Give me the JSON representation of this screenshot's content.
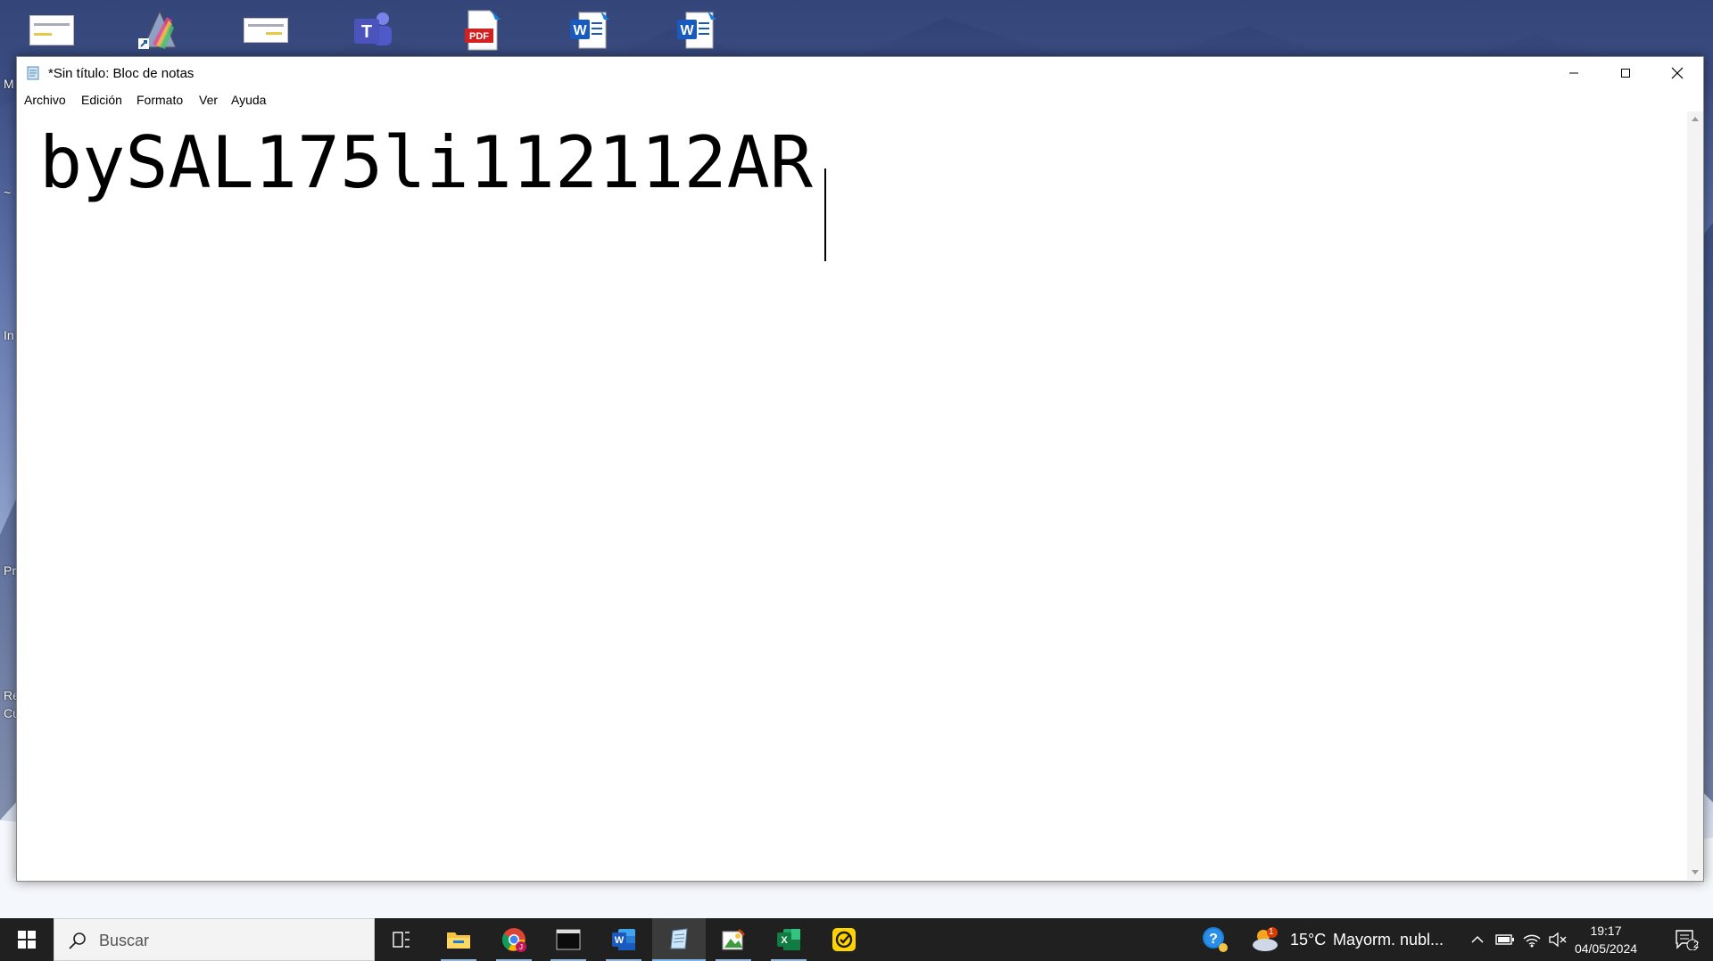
{
  "window": {
    "title": "*Sin título: Bloc de notas",
    "controls": [
      "minimize-icon",
      "maximize-icon",
      "close-icon"
    ]
  },
  "menu": [
    {
      "label": "Archivo"
    },
    {
      "label": "Edición"
    },
    {
      "label": "Formato"
    },
    {
      "label": "Ver"
    },
    {
      "label": "Ayuda"
    }
  ],
  "editor": {
    "content": "bySAL175li112112AR"
  },
  "desktop": {
    "icons": [
      "document-thumbnail-icon",
      "prism-shortcut-icon",
      "document-thumbnail-icon",
      "teams-icon",
      "pdf-icon",
      "word-document-icon",
      "word-document-icon"
    ],
    "edge_labels": [
      "M",
      "~",
      "In",
      "Pr",
      "Re",
      "Cu"
    ]
  },
  "taskbar": {
    "search_placeholder": "Buscar",
    "apps": [
      "task-view-icon",
      "file-explorer-icon",
      "chrome-icon",
      "terminal-icon",
      "word-icon",
      "notepad-icon",
      "image-editor-icon",
      "excel-icon",
      "norton-icon"
    ],
    "weather": {
      "temperature": "15°C",
      "condition": "Mayorm. nubl...",
      "badge": "1"
    },
    "clock": {
      "time": "19:17",
      "date": "04/05/2024"
    },
    "notification_count": "2"
  },
  "colors": {
    "taskbar": "#202020",
    "word_blue": "#185abd",
    "excel_green": "#107c41",
    "norton_yellow": "#ffd400"
  }
}
